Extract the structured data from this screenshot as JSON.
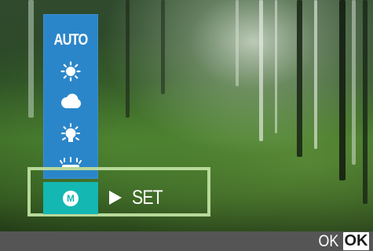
{
  "menu": {
    "items": [
      {
        "label": "AUTO",
        "icon": "auto"
      },
      {
        "icon": "sun-icon"
      },
      {
        "icon": "cloud-icon"
      },
      {
        "icon": "bulb-icon"
      },
      {
        "icon": "fluorescent-icon"
      }
    ],
    "selected": {
      "icon": "manual-icon",
      "letter": "M"
    },
    "set_label": "SET"
  },
  "bottom": {
    "ok_text": "OK",
    "ok_button": "OK"
  },
  "colors": {
    "menu_blue": "#2b86c9",
    "selected_teal": "#14b7b2",
    "frame_green": "#b7d99a",
    "bar_gray": "#555555"
  }
}
